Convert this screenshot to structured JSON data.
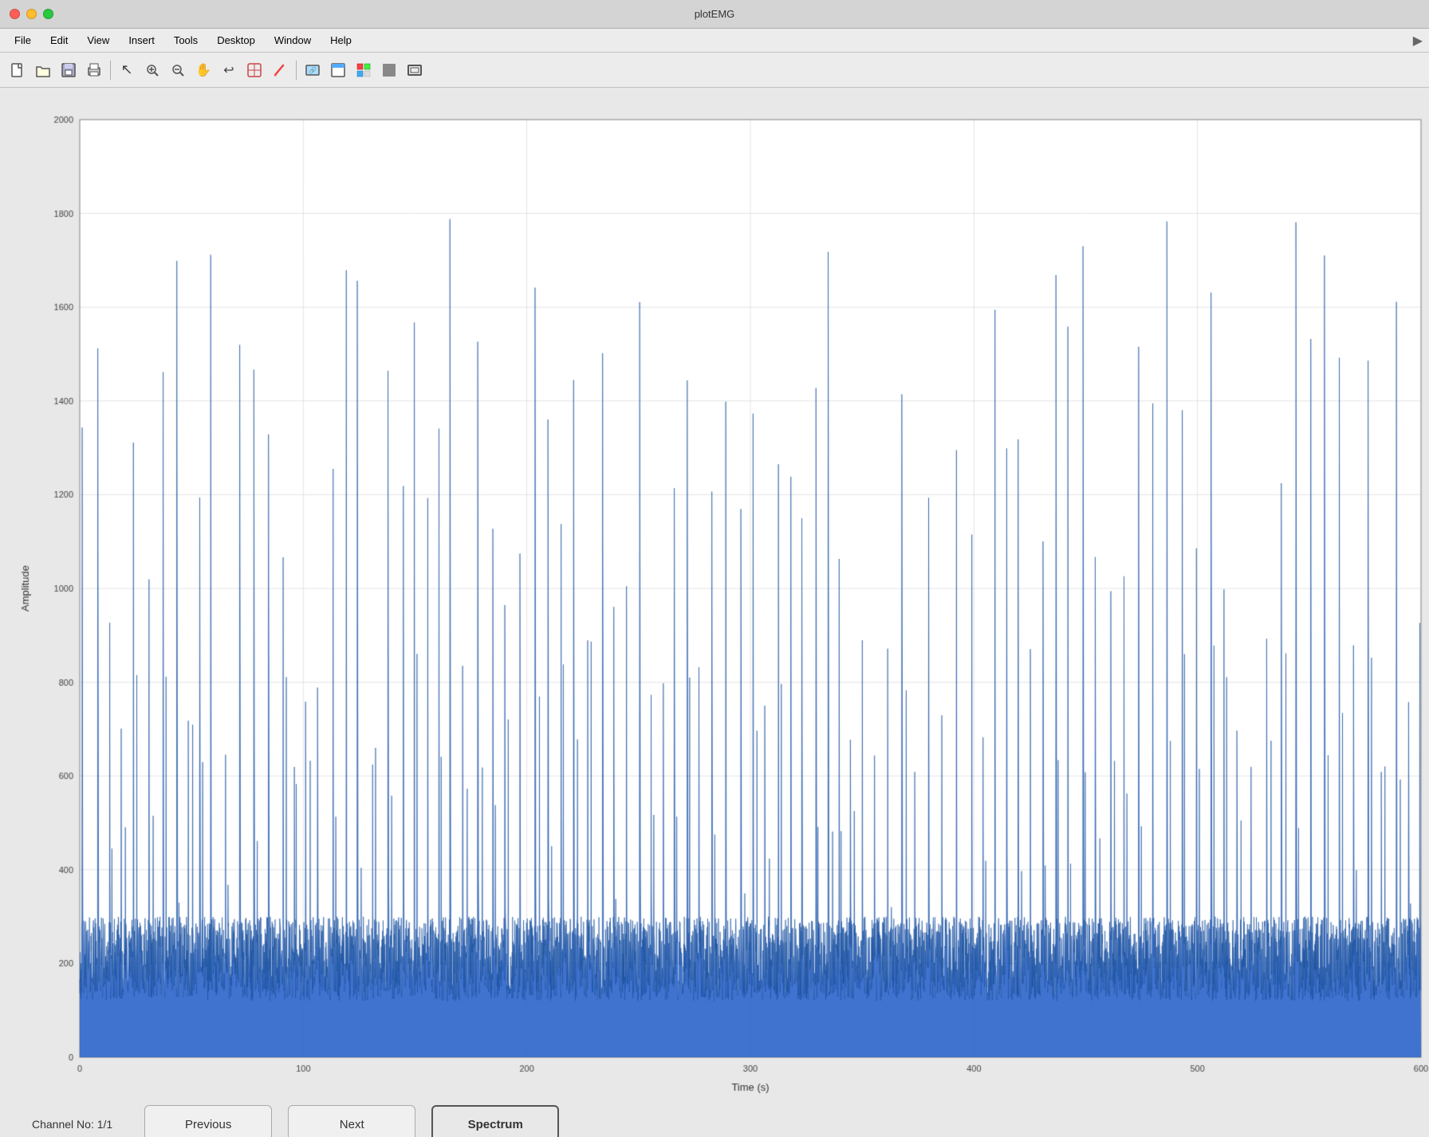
{
  "titlebar": {
    "title": "plotEMG"
  },
  "menubar": {
    "items": [
      "File",
      "Edit",
      "View",
      "Insert",
      "Tools",
      "Desktop",
      "Window",
      "Help"
    ]
  },
  "toolbar": {
    "buttons": [
      {
        "name": "new-file-icon",
        "icon": "📄"
      },
      {
        "name": "open-file-icon",
        "icon": "📂"
      },
      {
        "name": "save-icon",
        "icon": "💾"
      },
      {
        "name": "print-icon",
        "icon": "🖨️"
      },
      {
        "name": "separator",
        "icon": ""
      },
      {
        "name": "cursor-icon",
        "icon": "↖"
      },
      {
        "name": "zoom-in-icon",
        "icon": "🔍"
      },
      {
        "name": "zoom-out-icon",
        "icon": "🔍"
      },
      {
        "name": "pan-icon",
        "icon": "✋"
      },
      {
        "name": "undo-icon",
        "icon": "↩"
      },
      {
        "name": "data-cursor-icon",
        "icon": "⊕"
      },
      {
        "name": "brush-icon",
        "icon": "🖌️"
      },
      {
        "name": "separator2",
        "icon": ""
      },
      {
        "name": "link-icon",
        "icon": "🔗"
      },
      {
        "name": "phone-icon",
        "icon": "📱"
      },
      {
        "name": "grid-icon",
        "icon": "⊞"
      },
      {
        "name": "fill-icon",
        "icon": "▪"
      },
      {
        "name": "frame-icon",
        "icon": "▭"
      }
    ]
  },
  "chart": {
    "y_axis_label": "Amplitude",
    "x_axis_label": "Time (s)",
    "y_min": 0,
    "y_max": 2000,
    "x_min": 0,
    "x_max": 600,
    "y_ticks": [
      0,
      200,
      400,
      600,
      800,
      1000,
      1200,
      1400,
      1600,
      1800,
      2000
    ],
    "x_ticks": [
      0,
      100,
      200,
      300,
      400,
      500,
      600
    ]
  },
  "bottom": {
    "channel_label": "Channel No: 1/1",
    "prev_btn": "Previous",
    "next_btn": "Next",
    "spectrum_btn": "Spectrum"
  }
}
